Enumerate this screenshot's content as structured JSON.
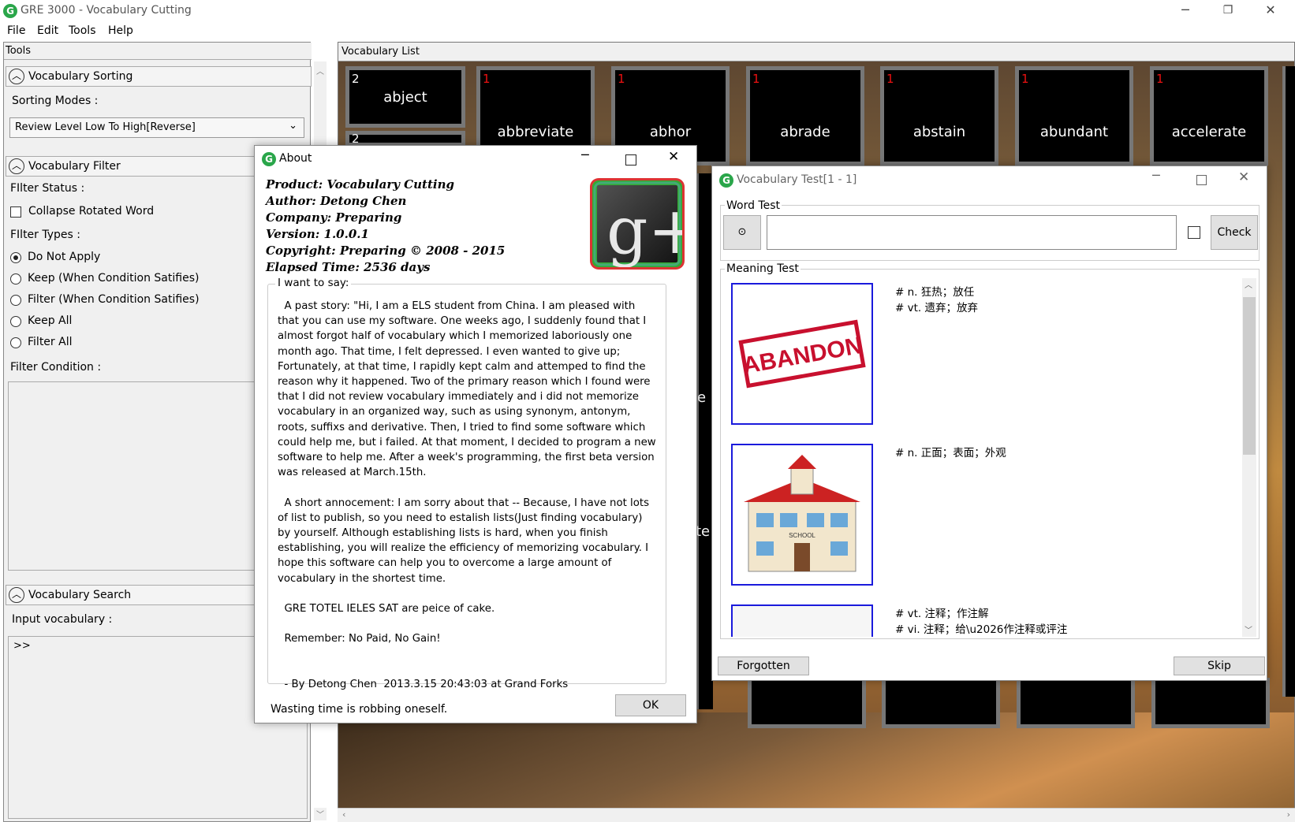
{
  "window": {
    "title": "GRE 3000 - Vocabulary Cutting",
    "icon": "app-logo-icon",
    "controls": {
      "minimize": "─",
      "restore": "❐",
      "close": "✕"
    }
  },
  "menu": [
    "File",
    "Edit",
    "Tools",
    "Help"
  ],
  "tools": {
    "header": "Tools",
    "sorting": {
      "title": "Vocabulary Sorting",
      "label": "Sorting Modes :",
      "selected": "Review Level Low To High[Reverse]",
      "arrow": "⌄"
    },
    "filter": {
      "title": "Vocabulary Filter",
      "status_label": "FIlter Status :",
      "collapse_label": "Collapse Rotated Word",
      "types_label": "FIlter Types :",
      "options": [
        "Do Not Apply",
        "Keep (When Condition Satifies)",
        "Filter (When Condition Satifies)",
        "Keep All",
        "Filter All"
      ],
      "selected_index": 0,
      "condition_label": "Filter Condition :"
    },
    "search": {
      "title": "Vocabulary Search",
      "input_label": "Input vocabulary :",
      "value": ">>"
    }
  },
  "vocab_list": {
    "header": "Vocabulary List",
    "cards": [
      {
        "num": "2",
        "word": "abject",
        "red": false
      },
      {
        "num": "1",
        "word": "abbreviate",
        "red": true
      },
      {
        "num": "1",
        "word": "abhor",
        "red": true
      },
      {
        "num": "1",
        "word": "abrade",
        "red": true
      },
      {
        "num": "1",
        "word": "abstain",
        "red": true
      },
      {
        "num": "1",
        "word": "abundant",
        "red": true
      },
      {
        "num": "1",
        "word": "accelerate",
        "red": true
      }
    ],
    "partial": {
      "second_row_num": "2",
      "mid_word_1": "e",
      "mid_word_2": "te"
    }
  },
  "about": {
    "title": "About",
    "product": "Product: Vocabulary Cutting",
    "author": "Author: Detong Chen",
    "company": "Company: Preparing",
    "version": "Version: 1.0.0.1",
    "copyright": "Copyright: Preparing © 2008 -  2015",
    "elapsed": "Elapsed Time: 2536 days",
    "logo_text": "g+",
    "legend": "I want to say:",
    "text": "  A past story: \"Hi, I am a ELS student from China. I am pleased with that you can use my software. One weeks ago, I suddenly found that I almost forgot half of vocabulary which I memorized laboriously one month ago. That time, I felt depressed. I even wanted to give up; Fortunately, at that time, I rapidly kept calm and attemped to find the reason why it happened. Two of the primary reason which I found were that I did not review vocabulary immediately and i did not memorize vocabulary in an organized way, such as using synonym, antonym, roots, suffixs and derivative. Then, I tried to find some software which could help me, but i failed. At that moment, I decided to program a new software to help me. After a week's programming, the first beta version was released at March.15th.\n\n  A short annocement: I am sorry about that -- Because, I have not lots of list to publish, so you need to estalish lists(Just finding vocabulary) by yourself. Although establishing lists is hard, when you finish establishing, you will realize the efficiency of memorizing vocabulary. I hope this software can help you to overcome a large amount of vocabulary in the shortest time.\n\n  GRE TOTEL IELES SAT are peice of cake.\n\n  Remember: No Paid, No Gain!\n\n\n  - By Detong Chen  2013.3.15 20:43:03 at Grand Forks",
    "footer": "Wasting time is robbing oneself.",
    "ok": "OK"
  },
  "test": {
    "title": "Vocabulary Test[1 - 1]",
    "word_test_label": "Word Test",
    "word_value": "",
    "radio_symbol": "⊙",
    "check": "Check",
    "meaning_label": "Meaning Test",
    "meanings": [
      {
        "lines": [
          "# n. 狂热；放任",
          "# vt. 遗弃；放弃"
        ],
        "image_text": "ABANDON",
        "image_icon": "abandon-stamp-image"
      },
      {
        "lines": [
          "# n. 正面；表面；外观"
        ],
        "image_text": "SCHOOL",
        "image_icon": "school-building-image"
      },
      {
        "lines": [
          "# vt. 注释；作注解",
          "# vi. 注释；给\\u2026作注释或评注"
        ],
        "image_text": "",
        "image_icon": "annotation-image"
      }
    ],
    "forgotten": "Forgotten",
    "skip": "Skip"
  },
  "colors": {
    "accent_green": "#2aa64a",
    "red_num": "#e11111",
    "selection_blue": "#1a1adc"
  }
}
